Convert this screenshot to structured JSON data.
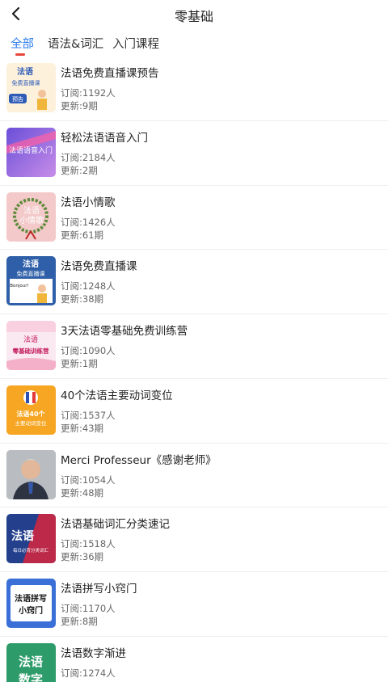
{
  "header": {
    "title": "零基础",
    "back_icon": "chevron-left-icon"
  },
  "tabs": [
    {
      "label": "全部",
      "active": true
    },
    {
      "label": "语法&词汇",
      "active": false
    },
    {
      "label": "入门课程",
      "active": false
    }
  ],
  "accent_color": "#2b7cf0",
  "indicator_color": "#e8463a",
  "courses": [
    {
      "title": "法语免费直播课预告",
      "subscribers": "订阅:1192人",
      "updates": "更新:9期",
      "thumb": {
        "kind": "preview",
        "lines": [
          "法语",
          "免费直播课"
        ],
        "badge": "预告"
      }
    },
    {
      "title": "轻松法语语音入门",
      "subscribers": "订阅:2184人",
      "updates": "更新:2期",
      "thumb": {
        "kind": "purple",
        "lines": [
          "法语语音入门"
        ]
      }
    },
    {
      "title": "法语小情歌",
      "subscribers": "订阅:1426人",
      "updates": "更新:61期",
      "thumb": {
        "kind": "wreath",
        "lines": [
          "法语",
          "小情歌"
        ]
      }
    },
    {
      "title": "法语免费直播课",
      "subscribers": "订阅:1248人",
      "updates": "更新:38期",
      "thumb": {
        "kind": "live",
        "lines": [
          "法语",
          "免费直播课",
          "Bonjour!"
        ]
      }
    },
    {
      "title": "3天法语零基础免费训练营",
      "subscribers": "订阅:1090人",
      "updates": "更新:1期",
      "thumb": {
        "kind": "camp",
        "lines": [
          "法语",
          "零基础训练营"
        ]
      }
    },
    {
      "title": "40个法语主要动词变位",
      "subscribers": "订阅:1537人",
      "updates": "更新:43期",
      "thumb": {
        "kind": "verbs",
        "lines": [
          "法语40个",
          "主要动词变位"
        ]
      }
    },
    {
      "title": "Merci Professeur《感谢老师》",
      "subscribers": "订阅:1054人",
      "updates": "更新:48期",
      "thumb": {
        "kind": "photo",
        "lines": []
      }
    },
    {
      "title": "法语基础词汇分类速记",
      "subscribers": "订阅:1518人",
      "updates": "更新:36期",
      "thumb": {
        "kind": "vocab",
        "lines": [
          "法语",
          "每日必背分类词汇"
        ]
      }
    },
    {
      "title": "法语拼写小窍门",
      "subscribers": "订阅:1170人",
      "updates": "更新:8期",
      "thumb": {
        "kind": "spell",
        "lines": [
          "法语拼写",
          "小窍门"
        ]
      }
    },
    {
      "title": "法语数字渐进",
      "subscribers": "订阅:1274人",
      "updates": "",
      "thumb": {
        "kind": "numbers",
        "lines": [
          "法语",
          "数字"
        ]
      }
    }
  ]
}
